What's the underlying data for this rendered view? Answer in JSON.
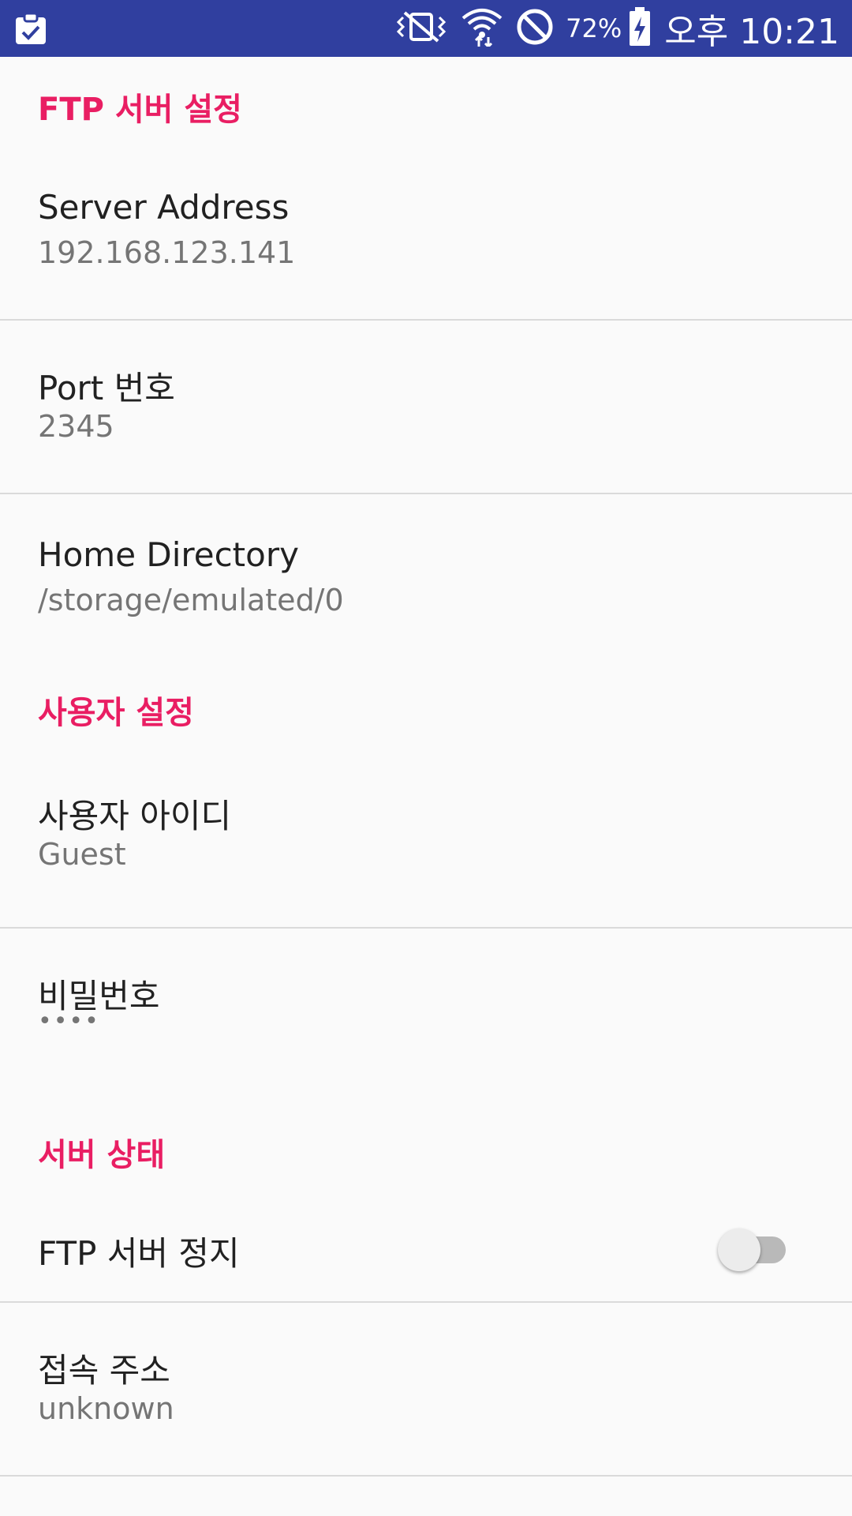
{
  "status_bar": {
    "battery_percent": "72%",
    "time": "오후 10:21",
    "icons": [
      "clipboard-check-icon",
      "vibrate-mute-icon",
      "wifi-icon",
      "do-not-disturb-icon",
      "battery-charging-icon"
    ]
  },
  "sections": {
    "ftp_settings": {
      "title": "FTP 서버 설정",
      "server_address": {
        "title": "Server Address",
        "summary": "192.168.123.141"
      },
      "port": {
        "title": "Port 번호",
        "summary": "2345"
      },
      "home_directory": {
        "title": "Home Directory",
        "summary": "/storage/emulated/0"
      }
    },
    "user_settings": {
      "title": "사용자 설정",
      "user_id": {
        "title": "사용자 아이디",
        "summary": "Guest"
      },
      "password": {
        "title": "비밀번호",
        "summary": "••••"
      }
    },
    "server_status": {
      "title": "서버 상태",
      "server_toggle": {
        "title": "FTP 서버 정지",
        "checked": false
      },
      "access_address": {
        "title": "접속 주소",
        "summary": "unknown"
      }
    }
  },
  "colors": {
    "status_bar": "#303f9f",
    "accent": "#e91e63",
    "background": "#fafafa"
  }
}
